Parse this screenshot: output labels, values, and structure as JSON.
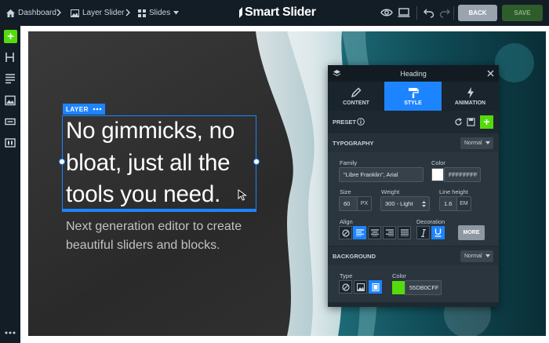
{
  "topbar": {
    "breadcrumb": [
      {
        "label": "Dashboard",
        "icon": "home-icon"
      },
      {
        "label": "Layer Slider",
        "icon": "image-icon"
      },
      {
        "label": "Slides",
        "icon": "grid-icon"
      }
    ],
    "logo_text": "Smart Slider",
    "back_label": "BACK",
    "save_label": "SAVE",
    "colors": {
      "bg": "#121d26",
      "save": "#2f5c2b",
      "back": "#99a4ae"
    }
  },
  "sidebar": {
    "items": [
      "add-icon",
      "heading-icon",
      "text-icon",
      "image-icon",
      "button-icon",
      "slider-icon",
      "more-icon"
    ],
    "accent": "#55db0c"
  },
  "canvas": {
    "layer_tag": "LAYER",
    "heading": "No gimmicks, no bloat, just all the tools you need.",
    "subtext": "Next generation editor to create beautiful sliders and blocks."
  },
  "panel": {
    "title": "Heading",
    "tabs": [
      {
        "label": "CONTENT",
        "active": false
      },
      {
        "label": "STYLE",
        "active": true
      },
      {
        "label": "ANIMATION",
        "active": false
      }
    ],
    "preset_label": "PRESET",
    "typography": {
      "label": "TYPOGRAPHY",
      "mode": "Normal",
      "family_label": "Family",
      "family_value": "\"Libre Franklin\", Arial",
      "color_label": "Color",
      "color_value": "FFFFFFFF",
      "size_label": "Size",
      "size_value": "60",
      "size_unit": "PX",
      "weight_label": "Weight",
      "weight_value": "300 - Light",
      "lineheight_label": "Line height",
      "lineheight_value": "1.6",
      "lineheight_unit": "EM",
      "align_label": "Align",
      "decoration_label": "Decoration",
      "more_label": "MORE"
    },
    "background": {
      "label": "BACKGROUND",
      "mode": "Normal",
      "type_label": "Type",
      "color_label": "Color",
      "color_value": "55DB0CFF",
      "swatch": "#55db0c"
    }
  }
}
